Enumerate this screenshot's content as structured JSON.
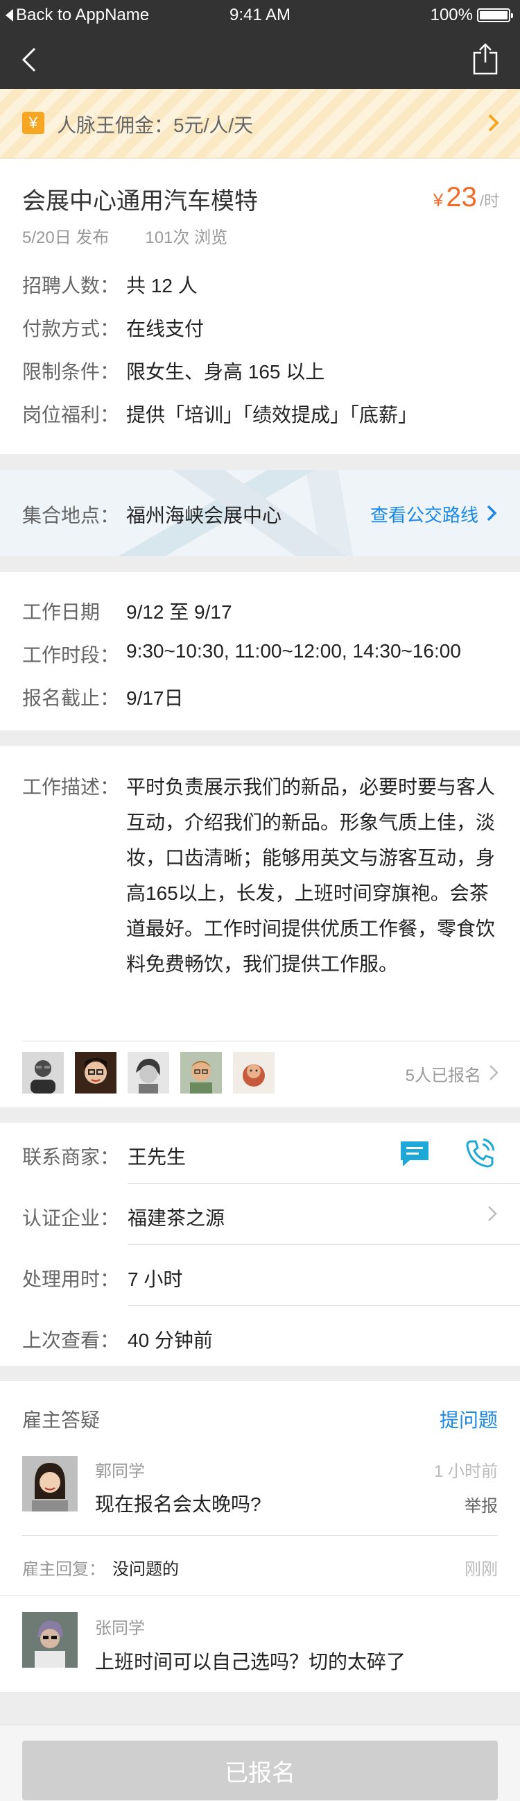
{
  "status_bar": {
    "back_label": "Back to AppName",
    "time": "9:41 AM",
    "battery": "100%"
  },
  "commission": {
    "icon": "yen-icon",
    "icon_glyph": "¥",
    "text": "人脉王佣金：5元/人/天"
  },
  "job": {
    "title": "会展中心通用汽车模特",
    "price_symbol": "¥",
    "price": "23",
    "price_unit": "/时",
    "posted": "5/20日 发布",
    "views": "101次 浏览",
    "details": [
      {
        "label": "招聘人数：",
        "value": "共 12 人"
      },
      {
        "label": "付款方式：",
        "value": "在线支付"
      },
      {
        "label": "限制条件：",
        "value": "限女生、身高 165 以上"
      },
      {
        "label": "岗位福利：",
        "value": "提供「培训」「绩效提成」「底薪」"
      }
    ]
  },
  "location": {
    "label": "集合地点：",
    "value": "福州海峡会展中心",
    "route_link": "查看公交路线"
  },
  "schedule": [
    {
      "label": "工作日期",
      "value": "9/12 至 9/17"
    },
    {
      "label": "工作时段：",
      "value": "9:30~10:30, 11:00~12:00, 14:30~16:00"
    },
    {
      "label": "报名截止：",
      "value": "9/17日"
    }
  ],
  "description": {
    "label": "工作描述：",
    "text": "平时负责展示我们的新品，必要时要与客人互动，介绍我们的新品。形象气质上佳，淡妆，口齿清晰；能够用英文与游客互动，身高165以上，长发，上班时间穿旗袍。会茶道最好。工作时间提供优质工作餐，零食饮料免费畅饮，我们提供工作服。",
    "signed_up": "5人已报名"
  },
  "contact": {
    "merchant_label": "联系商家：",
    "merchant": "王先生",
    "company_label": "认证企业：",
    "company": "福建茶之源",
    "process_label": "处理用时：",
    "process": "7 小时",
    "viewed_label": "上次查看：",
    "viewed": "40 分钟前"
  },
  "qa": {
    "title": "雇主答疑",
    "ask_button": "提问题",
    "items": [
      {
        "name": "郭同学",
        "question": "现在报名会太晚吗?",
        "time": "1 小时前",
        "report": "举报",
        "reply_label": "雇主回复：",
        "reply": "没问题的",
        "reply_time": "刚刚"
      },
      {
        "name": "张同学",
        "question": "上班时间可以自己选吗？切的太碎了"
      }
    ]
  },
  "footer": {
    "button": "已报名"
  },
  "colors": {
    "accent_blue": "#1b88e6",
    "price_orange": "#f26b2b",
    "banner_orange": "#f6a623",
    "nav_dark": "#333333"
  }
}
